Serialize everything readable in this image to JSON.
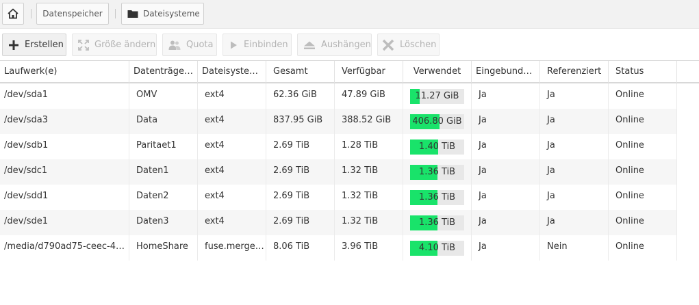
{
  "breadcrumb": {
    "home_icon": "home-icon",
    "storage_label": "Datenspeicher",
    "filesystems_label": "Dateisysteme",
    "folder_icon": "folder-icon"
  },
  "toolbar": {
    "create_label": "Erstellen",
    "resize_label": "Größe ändern",
    "quota_label": "Quota",
    "mount_label": "Einbinden",
    "unmount_label": "Aushängen",
    "delete_label": "Löschen"
  },
  "columns": [
    "Laufwerk(e)",
    "Datenträge…",
    "Dateisyste…",
    "Gesamt",
    "Verfügbar",
    "Verwendet",
    "Eingebund…",
    "Referenziert",
    "Status"
  ],
  "rows": [
    {
      "device": "/dev/sda1",
      "label": "OMV",
      "fs": "ext4",
      "total": "62.36 GiB",
      "available": "47.89 GiB",
      "used": "11.27 GiB",
      "used_fraction": 0.18,
      "mounted": "Ja",
      "referenced": "Ja",
      "status": "Online"
    },
    {
      "device": "/dev/sda3",
      "label": "Data",
      "fs": "ext4",
      "total": "837.95 GiB",
      "available": "388.52 GiB",
      "used": "406.80 GiB",
      "used_fraction": 0.54,
      "mounted": "Ja",
      "referenced": "Ja",
      "status": "Online"
    },
    {
      "device": "/dev/sdb1",
      "label": "Paritaet1",
      "fs": "ext4",
      "total": "2.69 TiB",
      "available": "1.28 TiB",
      "used": "1.40 TiB",
      "used_fraction": 0.52,
      "mounted": "Ja",
      "referenced": "Ja",
      "status": "Online"
    },
    {
      "device": "/dev/sdc1",
      "label": "Daten1",
      "fs": "ext4",
      "total": "2.69 TiB",
      "available": "1.32 TiB",
      "used": "1.36 TiB",
      "used_fraction": 0.51,
      "mounted": "Ja",
      "referenced": "Ja",
      "status": "Online"
    },
    {
      "device": "/dev/sdd1",
      "label": "Daten2",
      "fs": "ext4",
      "total": "2.69 TiB",
      "available": "1.32 TiB",
      "used": "1.36 TiB",
      "used_fraction": 0.51,
      "mounted": "Ja",
      "referenced": "Ja",
      "status": "Online"
    },
    {
      "device": "/dev/sde1",
      "label": "Daten3",
      "fs": "ext4",
      "total": "2.69 TiB",
      "available": "1.32 TiB",
      "used": "1.36 TiB",
      "used_fraction": 0.51,
      "mounted": "Ja",
      "referenced": "Ja",
      "status": "Online"
    },
    {
      "device": "/media/d790ad75-ceec-46…",
      "label": "HomeShare",
      "fs": "fuse.merge…",
      "total": "8.06 TiB",
      "available": "3.96 TiB",
      "used": "4.10 TiB",
      "used_fraction": 0.51,
      "mounted": "Ja",
      "referenced": "Nein",
      "status": "Online"
    }
  ],
  "colors": {
    "bar_fill": "#19e36a",
    "bar_track": "#e8e8e8"
  }
}
